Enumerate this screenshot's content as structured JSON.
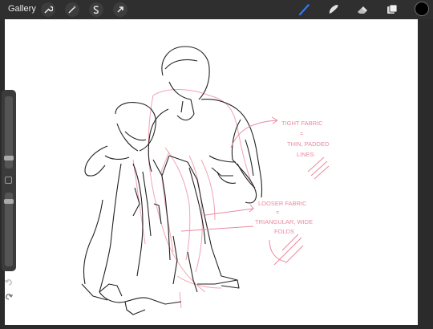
{
  "app": {
    "gallery_label": "Gallery"
  },
  "toolbar": {
    "left_tools": [
      "wrench-icon",
      "magic-wand-icon",
      "selection-icon",
      "transform-arrow-icon"
    ],
    "right_tools": [
      "brush-icon",
      "smudge-icon",
      "eraser-icon",
      "layers-icon"
    ],
    "active_tool": "brush-icon",
    "accent_color": "#2f7bf6",
    "current_color": "#000000"
  },
  "sidebar": {
    "brush_size_level": 0.6,
    "opacity_level": 0.3
  },
  "canvas": {
    "annotation_1": [
      "TIGHT FABRIC",
      "=",
      "THIN, PADDED",
      "LINES"
    ],
    "annotation_2": [
      "LOOSER FABRIC",
      "=",
      "TRIANGULAR, WIDE",
      "FOLDS"
    ],
    "annotation_color": "#e98aa0",
    "lineart_color": "#222222",
    "sketch_color": "#f2a3b3"
  }
}
